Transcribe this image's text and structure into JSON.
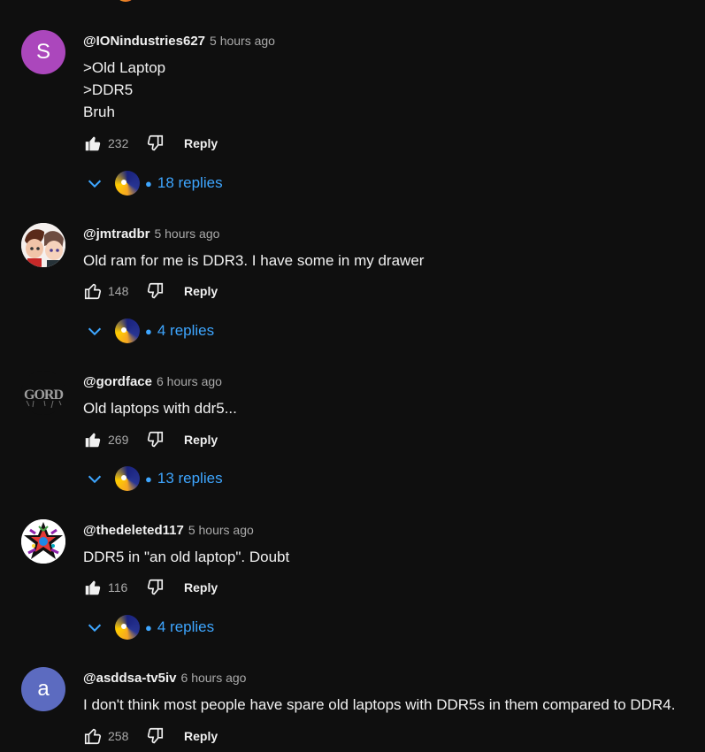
{
  "comments": [
    {
      "author": "@IONindustries627",
      "time": "5 hours ago",
      "avatar_letter": "S",
      "lines": [
        ">Old Laptop",
        ">DDR5",
        "Bruh"
      ],
      "likes": "232",
      "liked": true,
      "reply_label": "Reply",
      "replies_label": "18 replies"
    },
    {
      "author": "@jmtradbr",
      "time": "5 hours ago",
      "avatar_letter": "",
      "lines": [
        "Old ram for me is DDR3. I have some in my drawer"
      ],
      "likes": "148",
      "liked": false,
      "reply_label": "Reply",
      "replies_label": "4 replies"
    },
    {
      "author": "@gordface",
      "time": "6 hours ago",
      "avatar_letter": "",
      "lines": [
        "Old laptops with ddr5..."
      ],
      "likes": "269",
      "liked": true,
      "reply_label": "Reply",
      "replies_label": "13 replies"
    },
    {
      "author": "@thedeleted117",
      "time": "5 hours ago",
      "avatar_letter": "",
      "lines": [
        "DDR5 in \"an old laptop\". Doubt"
      ],
      "likes": "116",
      "liked": true,
      "reply_label": "Reply",
      "replies_label": "4 replies"
    },
    {
      "author": "@asddsa-tv5iv",
      "time": "6 hours ago",
      "avatar_letter": "a",
      "lines": [
        "I don't think most people have spare old laptops with DDR5s in them compared to DDR4."
      ],
      "likes": "258",
      "liked": false,
      "reply_label": "Reply",
      "replies_label": ""
    }
  ],
  "gord_logo_text": "GORD",
  "colors": {
    "background": "#0f0f0f",
    "text": "#f1f1f1",
    "muted": "#aaaaaa",
    "link": "#3ea6ff"
  },
  "icons": [
    "thumbs-up-icon",
    "thumbs-down-icon",
    "chevron-down-icon"
  ]
}
